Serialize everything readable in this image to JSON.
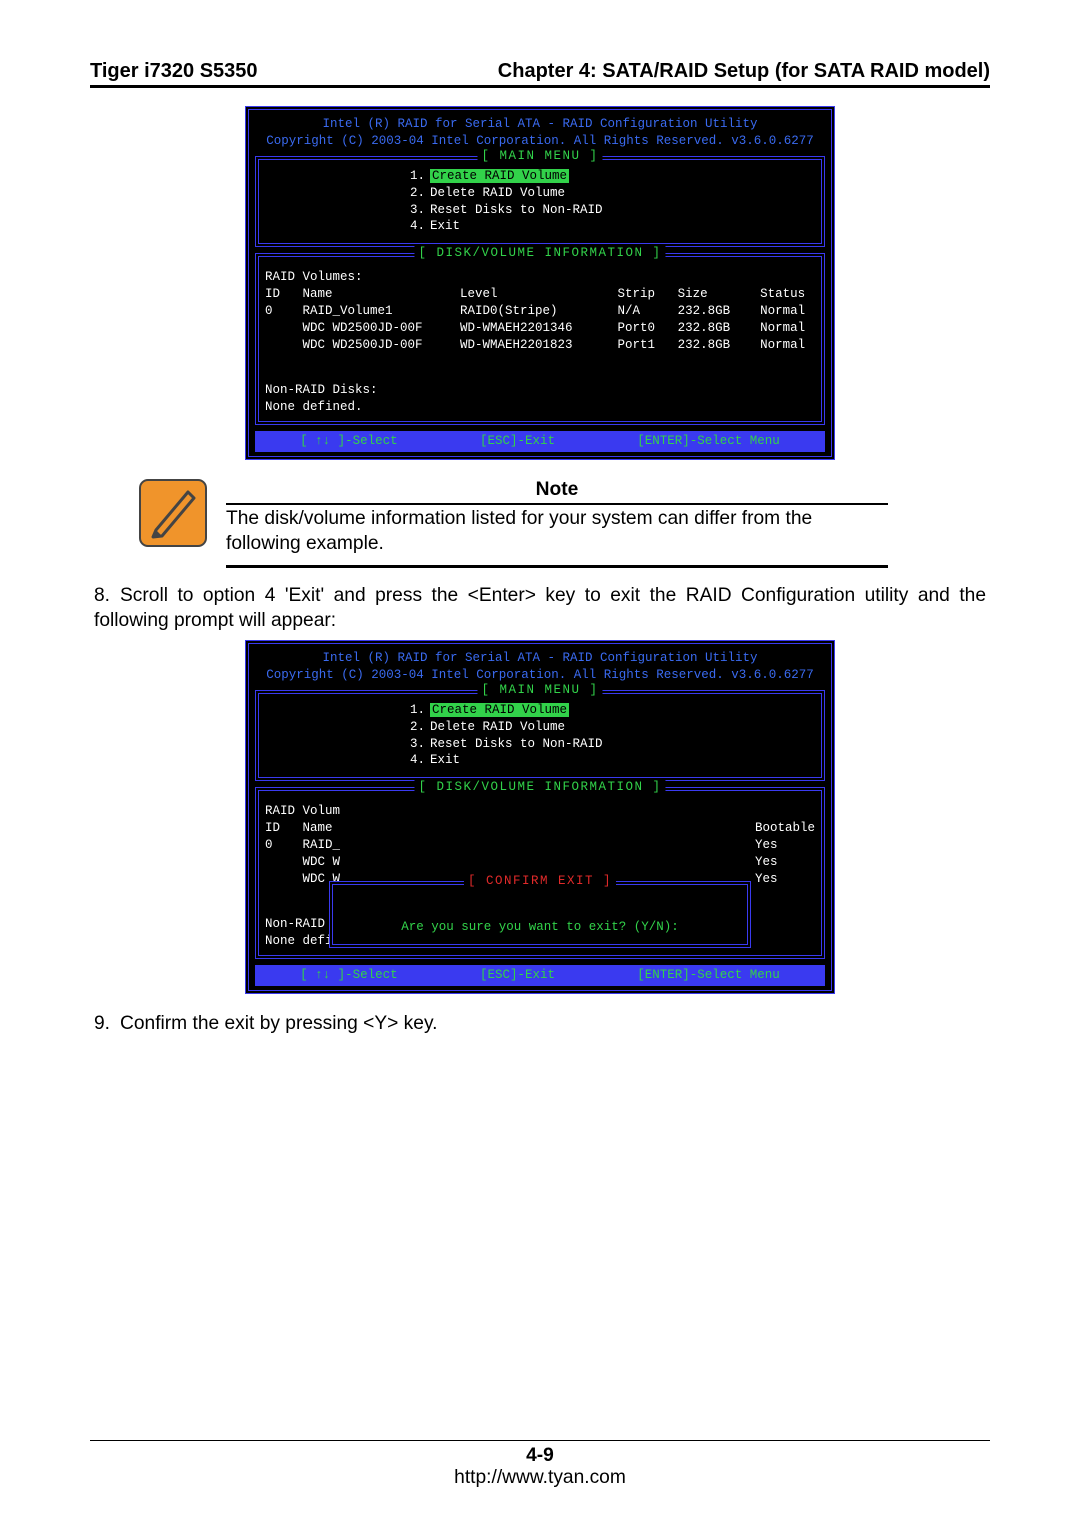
{
  "header": {
    "left": "Tiger i7320 S5350",
    "right": "Chapter 4: SATA/RAID Setup (for SATA RAID model)"
  },
  "bios": {
    "title1": "Intel (R) RAID for Serial ATA - RAID Configuration Utility",
    "title2": "Copyright (C) 2003-04 Intel Corporation. All Rights Reserved. v3.6.0.6277",
    "main_menu_label": "[ MAIN MENU ]",
    "menu_items": [
      {
        "n": "1.",
        "label": "Create RAID Volume",
        "hl": true
      },
      {
        "n": "2.",
        "label": "Delete RAID Volume",
        "hl": false
      },
      {
        "n": "3.",
        "label": "Reset Disks to Non-RAID",
        "hl": false
      },
      {
        "n": "4.",
        "label": "Exit",
        "hl": false
      }
    ],
    "disk_info_label": "[ DISK/VOLUME INFORMATION ]",
    "raid_volumes_label": "RAID Volumes:",
    "table_header": "ID   Name                 Level                Strip   Size       Status    Bootable",
    "table_rows": [
      "0    RAID_Volume1         RAID0(Stripe)        N/A     232.8GB    Normal     Yes",
      "     WDC WD2500JD-00F     WD-WMAEH2201346      Port0   232.8GB    Normal     Yes",
      "     WDC WD2500JD-00F     WD-WMAEH2201823      Port1   232.8GB    Normal     Yes"
    ],
    "non_raid_label": "Non-RAID Disks:",
    "none_defined": "None defined.",
    "footer": {
      "select": "[ ↑↓ ]-Select",
      "esc": "[ESC]-Exit",
      "enter": "[ENTER]-Select Menu"
    }
  },
  "note": {
    "heading": "Note",
    "body": "The disk/volume information listed for your system can differ from the following example."
  },
  "step8_prefix": "8.",
  "step8": "Scroll to option 4 'Exit' and press the <Enter> key to exit the RAID Configuration utility and the following prompt will appear:",
  "confirm": {
    "label": "[ CONFIRM EXIT ]",
    "text": "Are you sure you want to exit? (Y/N):",
    "raid_volumes_label": "RAID Volum",
    "table_header": "ID   Name",
    "rows": [
      "0    RAID_",
      "     WDC W",
      "     WDC W"
    ],
    "boot_header": "Bootable",
    "boot_rows": [
      "Yes",
      "Yes",
      "Yes"
    ]
  },
  "step9_prefix": "9.",
  "step9": "Confirm the exit by pressing <Y> key.",
  "footer": {
    "page": "4-9",
    "url": "http://www.tyan.com"
  }
}
